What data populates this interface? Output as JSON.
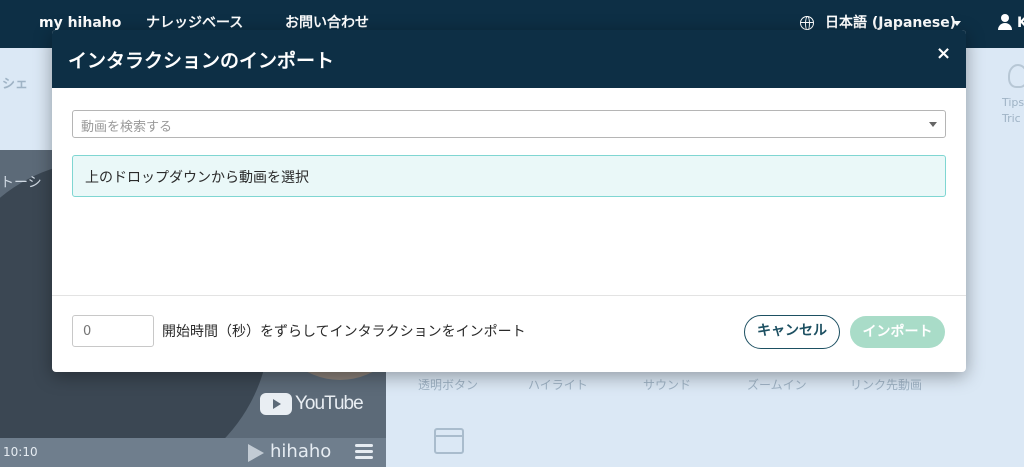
{
  "topnav": {
    "links": [
      "my hihaho",
      "ナレッジベース",
      "お問い合わせ"
    ],
    "language": "日本語 (Japanese)",
    "user_initial": "K"
  },
  "background": {
    "share_fragment": "シェ",
    "video_title_fragment": "トーシ",
    "youtube_label": "YouTube",
    "video_time": "10:10",
    "brand": "hihaho",
    "tips_label": [
      "Tips",
      "Tric"
    ],
    "tools": [
      "透明ボタン",
      "ハイライト",
      "サウンド",
      "ズームイン",
      "リンク先動画"
    ]
  },
  "modal": {
    "title": "インタラクションのインポート",
    "close_icon": "×",
    "video_select_placeholder": "動画を検索する",
    "info_message": "上のドロップダウンから動画を選択",
    "offset_value": "0",
    "offset_label": "開始時間（秒）をずらしてインタラクションをインポート",
    "cancel_label": "キャンセル",
    "import_label": "インポート"
  },
  "colors": {
    "header_bg": "#0d2f45",
    "accent": "#1d5062",
    "import_disabled": "#a9dcc8",
    "info_bg": "#eaf8f8",
    "info_border": "#7fd6d2"
  }
}
